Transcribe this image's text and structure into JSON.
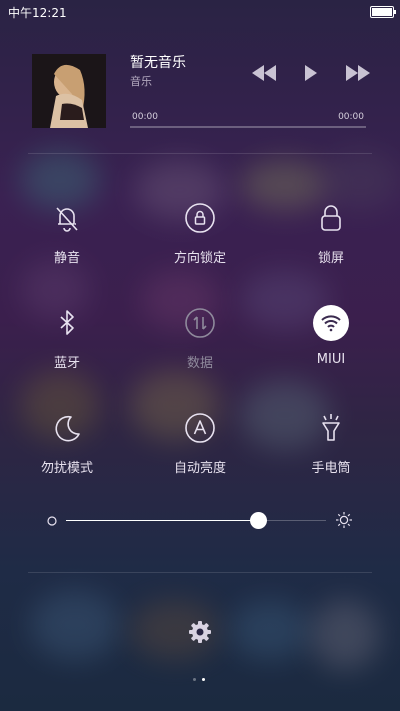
{
  "status_bar": {
    "time": "中午12:21",
    "battery_icon": "battery-icon"
  },
  "music": {
    "title": "暂无音乐",
    "artist": "音乐",
    "time_elapsed": "00:00",
    "time_total": "00:00",
    "progress": 0,
    "controls": [
      "previous-icon",
      "play-icon",
      "next-icon"
    ]
  },
  "toggles": [
    {
      "label": "静音",
      "icon": "bell-off-icon",
      "active": false
    },
    {
      "label": "方向锁定",
      "icon": "rotation-lock-icon",
      "active": false
    },
    {
      "label": "锁屏",
      "icon": "lock-icon",
      "active": false
    },
    {
      "label": "蓝牙",
      "icon": "bluetooth-icon",
      "active": false
    },
    {
      "label": "数据",
      "icon": "mobile-data-icon",
      "active": false,
      "disabled": true
    },
    {
      "label": "MIUI",
      "icon": "wifi-icon",
      "active": true
    },
    {
      "label": "勿扰模式",
      "icon": "moon-icon",
      "active": false
    },
    {
      "label": "自动亮度",
      "icon": "auto-brightness-icon",
      "active": false
    },
    {
      "label": "手电筒",
      "icon": "flashlight-icon",
      "active": false
    }
  ],
  "brightness": {
    "level": 0.74,
    "min_icon": "brightness-low-icon",
    "max_icon": "brightness-high-icon"
  },
  "settings_icon": "gear-icon",
  "page_indicator": {
    "total": 2,
    "current": 2
  },
  "colors": {
    "active_circle": "#ffffff",
    "icon_color": "#e8e2f0",
    "disabled_color": "#8f8a9c"
  }
}
